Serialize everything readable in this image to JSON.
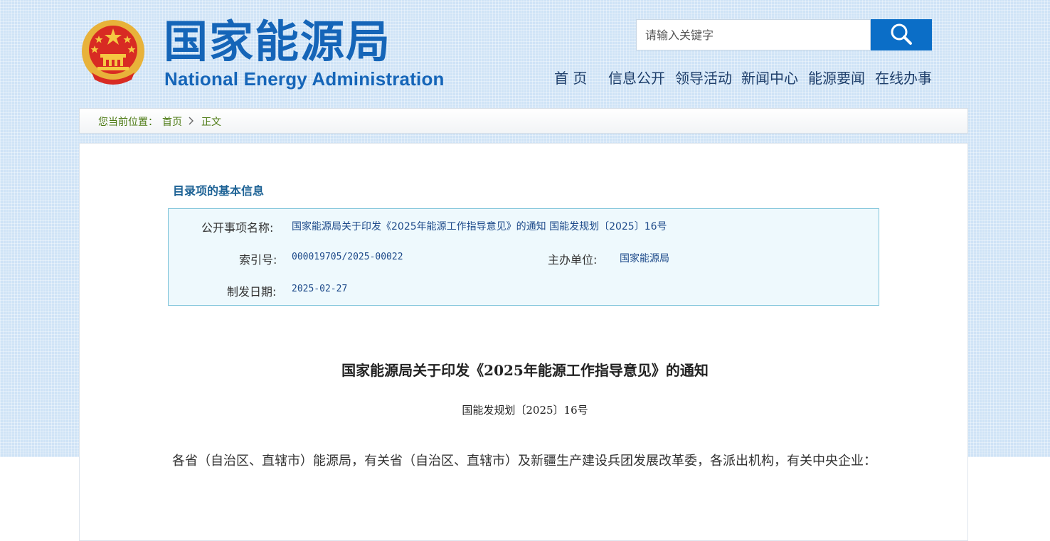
{
  "header": {
    "site_name_cn": "国家能源局",
    "site_name_en": "National Energy Administration",
    "emblem_icon": "national-emblem-icon"
  },
  "search": {
    "placeholder": "请输入关键字",
    "button_icon": "search-icon"
  },
  "nav": {
    "items": [
      {
        "label": "首 页"
      },
      {
        "label": "信息公开"
      },
      {
        "label": "领导活动"
      },
      {
        "label": "新闻中心"
      },
      {
        "label": "能源要闻"
      },
      {
        "label": "在线办事"
      }
    ]
  },
  "breadcrumb": {
    "prefix": "您当前位置：",
    "home": "首页",
    "separator_icon": "chevron-right-icon",
    "current": "正文"
  },
  "info": {
    "heading": "目录项的基本信息",
    "name_label": "公开事项名称:",
    "name_value": "国家能源局关于印发《2025年能源工作指导意见》的通知 国能发规划〔2025〕16号",
    "index_label": "索引号:",
    "index_value": "000019705/2025-00022",
    "org_label": "主办单位:",
    "org_value": "国家能源局",
    "date_label": "制发日期:",
    "date_value": "2025-02-27"
  },
  "document": {
    "title": "国家能源局关于印发《2025年能源工作指导意见》的通知",
    "number": "国能发规划〔2025〕16号",
    "body": "各省（自治区、直辖市）能源局，有关省（自治区、直辖市）及新疆生产建设兵团发展改革委，各派出机构，有关中央企业："
  },
  "colors": {
    "brand_blue": "#1565b8",
    "search_button": "#0b6ec7",
    "breadcrumb_green": "#4c7a13",
    "info_heading": "#1d6295",
    "info_box_bg": "#eef9fd",
    "info_box_border": "#7cc3d9"
  }
}
